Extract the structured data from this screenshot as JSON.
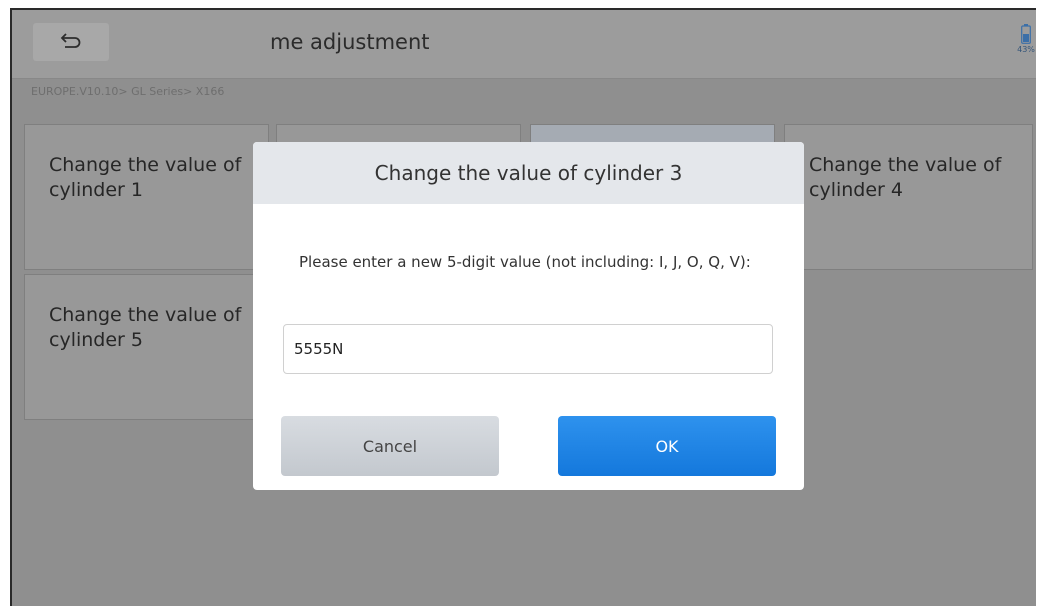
{
  "header": {
    "title": "me adjustment",
    "battery_label": "43%"
  },
  "breadcrumb": "EUROPE.V10.10> GL Series> X166",
  "tiles": [
    {
      "label": "Change the value of cylinder 1"
    },
    {
      "label": ""
    },
    {
      "label": ""
    },
    {
      "label": "Change the value of cylinder 4"
    },
    {
      "label": "Change the value of cylinder 5"
    }
  ],
  "dialog": {
    "title": "Change the value of cylinder 3",
    "message": "Please enter a new 5-digit value (not including: I, J, O, Q, V):",
    "input_value": "5555N",
    "cancel_label": "Cancel",
    "ok_label": "OK"
  },
  "icons": {
    "back": "back-arrow-icon",
    "battery": "battery-icon"
  },
  "colors": {
    "ok_button": "#1E82E6",
    "dialog_header": "#E4E7EB"
  }
}
